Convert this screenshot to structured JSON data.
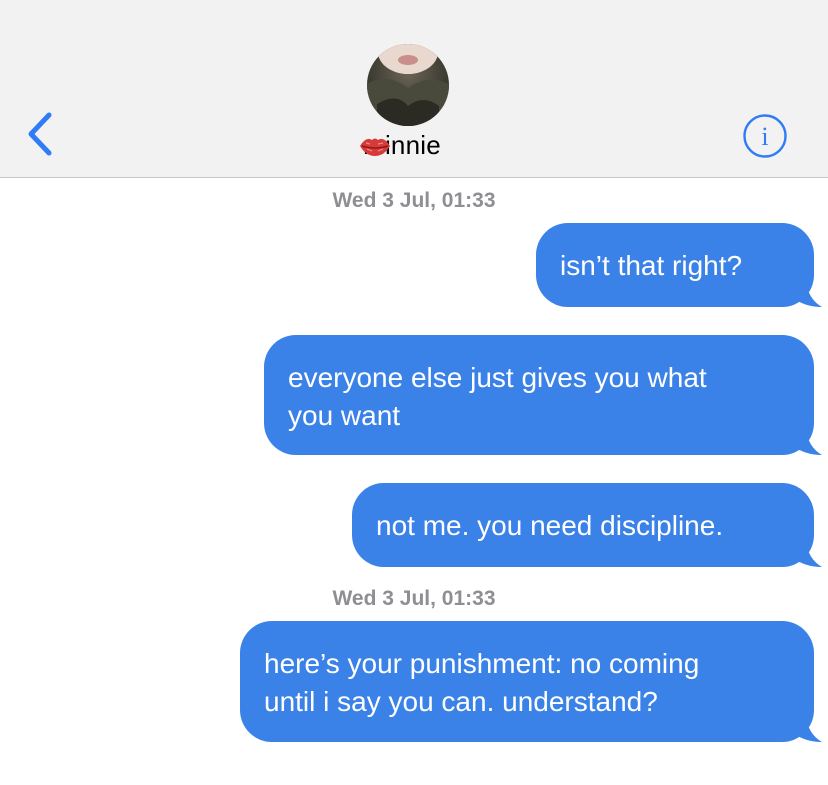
{
  "header": {
    "contact_name": "minnie",
    "contact_emoji_icon": "kiss-mark-icon",
    "back_icon": "chevron-left-icon",
    "info_icon": "info-icon",
    "accent_color": "#2f7cf6"
  },
  "conversation": {
    "timestamps": [
      "Wed 3 Jul, 01:33",
      "Wed 3 Jul, 01:33"
    ],
    "messages": [
      {
        "sender": "me",
        "text": "isn’t that right?"
      },
      {
        "sender": "me",
        "text": "everyone else just gives you what\nyou want"
      },
      {
        "sender": "me",
        "text": "not me. you need discipline."
      },
      {
        "sender": "me",
        "text": "here’s your punishment: no coming\nuntil i say you can. understand?"
      }
    ],
    "bubble_color": "#3b82e8"
  }
}
